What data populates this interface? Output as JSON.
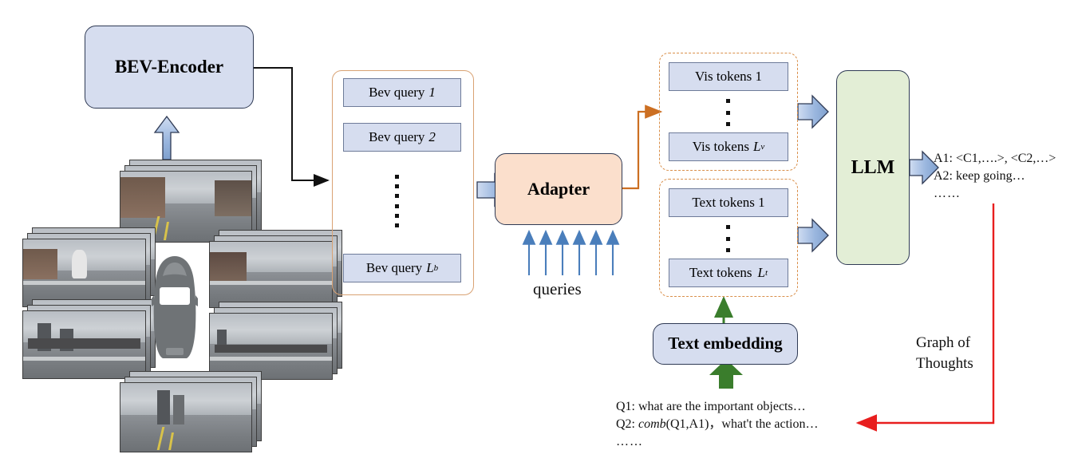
{
  "nodes": {
    "bev_encoder": "BEV-Encoder",
    "adapter": "Adapter",
    "llm": "LLM",
    "text_embedding": "Text embedding"
  },
  "bev_queries": {
    "items": [
      "Bev query 1",
      "Bev query 2",
      "Bev query L"
    ],
    "item1_label": "Bev query",
    "item1_index": "1",
    "item2_label": "Bev query",
    "item2_index": "2",
    "item3_label": "Bev query",
    "item3_sub_base": "L",
    "item3_sub": "b"
  },
  "vis_tokens": {
    "first_label": "Vis tokens 1",
    "last_label": "Vis tokens",
    "last_sub_base": "L",
    "last_sub": "v"
  },
  "text_tokens": {
    "first_label": "Text tokens 1",
    "last_label": "Text tokens",
    "last_sub_base": "L",
    "last_sub": "t"
  },
  "labels": {
    "queries": "queries",
    "graph_of_thoughts_line1": "Graph of",
    "graph_of_thoughts_line2": "Thoughts"
  },
  "llm_output": {
    "line1": "A1: <C1,….>, <C2,…>",
    "line2": "A2: keep going…",
    "line3": "……"
  },
  "questions": {
    "line1": "Q1: what are the important objects…",
    "line2_prefix": "Q2: ",
    "line2_italic": "comb",
    "line2_suffix": "(Q1,A1)，what't the action…",
    "line3": "……"
  },
  "colors": {
    "box_blue_fill": "#d6ddef",
    "box_peach_fill": "#fbdfcc",
    "box_green_fill": "#e3eed6",
    "box_border": "#2f3a54",
    "group_orange_solid": "#d9a273",
    "group_orange_dashed": "#d98f4a",
    "arrow_blue": "#4a7ebb",
    "arrow_blue_block_fill": "#9bb7df",
    "arrow_green": "#3a7d2c",
    "arrow_red": "#e81e1e",
    "connector_black": "#111111",
    "ego_car": "#6f7376"
  },
  "cameras": {
    "count": 6,
    "frames_per_stack": 3,
    "positions": [
      "front",
      "front-left",
      "front-right",
      "back-left",
      "back-right",
      "back"
    ]
  }
}
